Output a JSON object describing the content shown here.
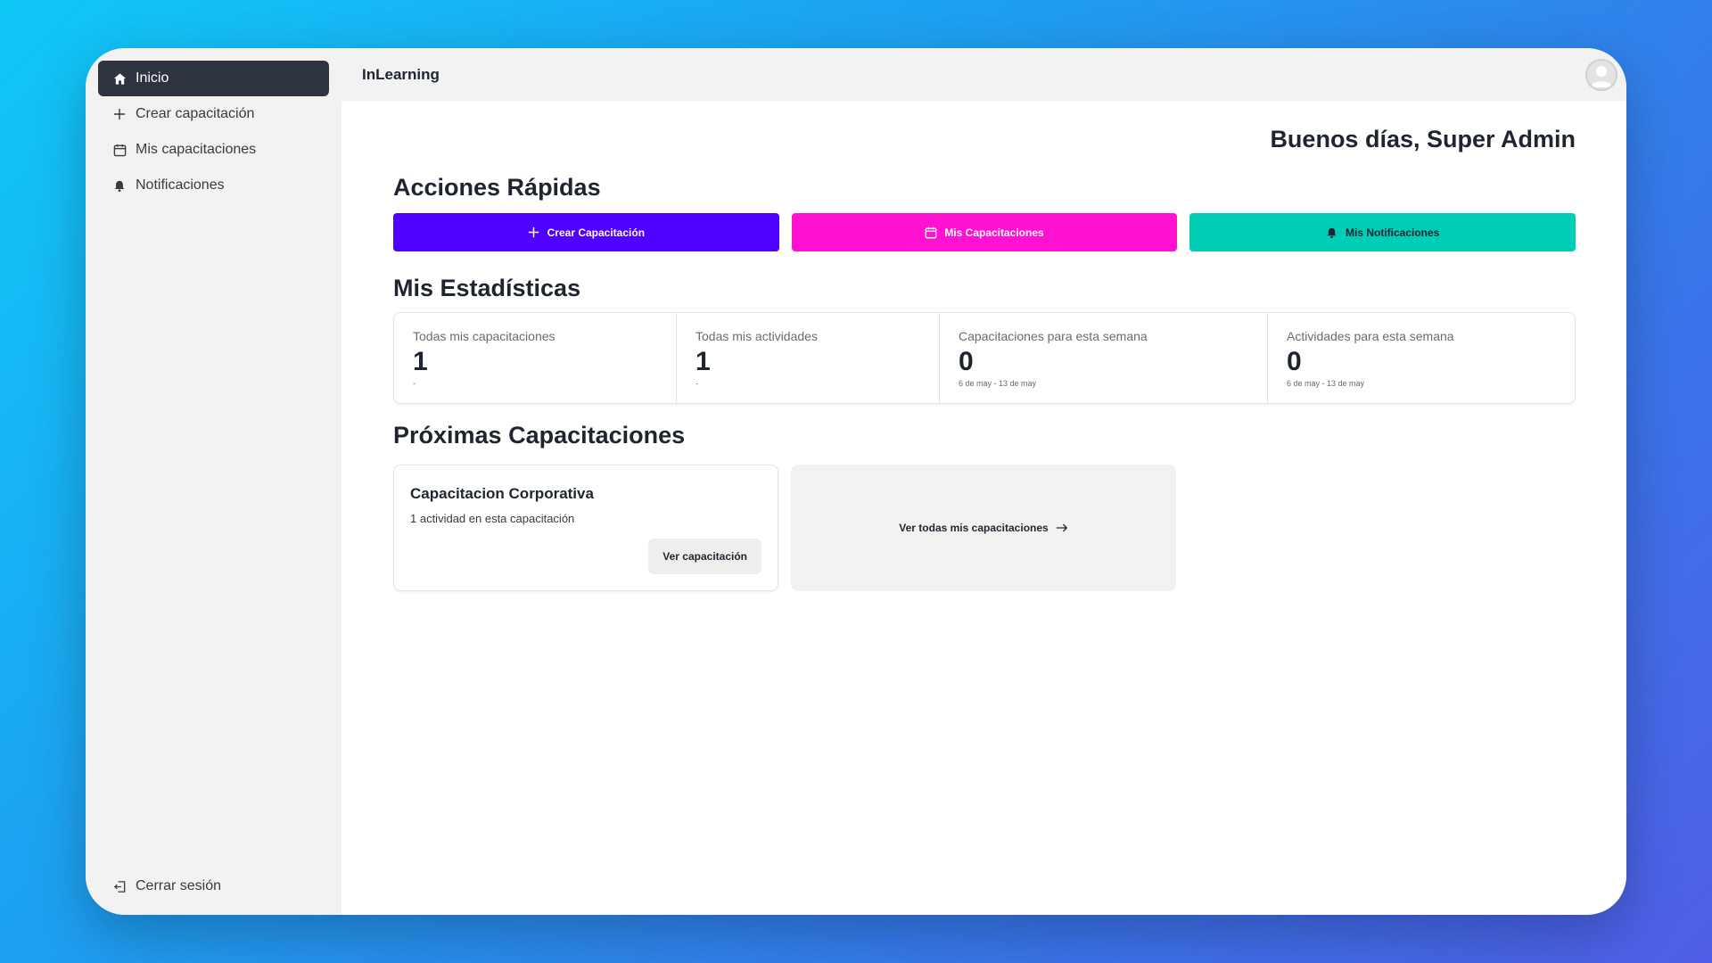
{
  "app": {
    "title": "InLearning"
  },
  "sidebar": {
    "items": [
      {
        "label": "Inicio",
        "icon": "home-icon",
        "active": true
      },
      {
        "label": "Crear capacitación",
        "icon": "plus-icon"
      },
      {
        "label": "Mis capacitaciones",
        "icon": "calendar-icon"
      },
      {
        "label": "Notificaciones",
        "icon": "bell-icon"
      }
    ],
    "logout_label": "Cerrar sesión"
  },
  "header": {
    "greeting": "Buenos días, Super Admin"
  },
  "quick_actions": {
    "title": "Acciones Rápidas",
    "buttons": [
      {
        "label": "Crear Capacitación",
        "icon": "plus-icon",
        "color": "#4f00ff"
      },
      {
        "label": "Mis Capacitaciones",
        "icon": "calendar-icon",
        "color": "#ff12d2"
      },
      {
        "label": "Mis Notificaciones",
        "icon": "bell-icon",
        "color": "#00cdb6"
      }
    ]
  },
  "stats": {
    "title": "Mis Estadísticas",
    "cards": [
      {
        "label": "Todas mis capacitaciones",
        "value": "1",
        "sub": "-"
      },
      {
        "label": "Todas mis actividades",
        "value": "1",
        "sub": "-"
      },
      {
        "label": "Capacitaciones para esta semana",
        "value": "0",
        "sub": "6 de may - 13 de may"
      },
      {
        "label": "Actividades para esta semana",
        "value": "0",
        "sub": "6 de may - 13 de may"
      }
    ]
  },
  "upcoming": {
    "title": "Próximas Capacitaciones",
    "courses": [
      {
        "name": "Capacitacion Corporativa",
        "subtitle": "1 actividad en esta capacitación",
        "button": "Ver capacitación"
      }
    ],
    "see_all_label": "Ver todas mis capacitaciones"
  },
  "colors": {
    "sidebar_active": "#2d3440",
    "text_dark": "#1f2530"
  }
}
